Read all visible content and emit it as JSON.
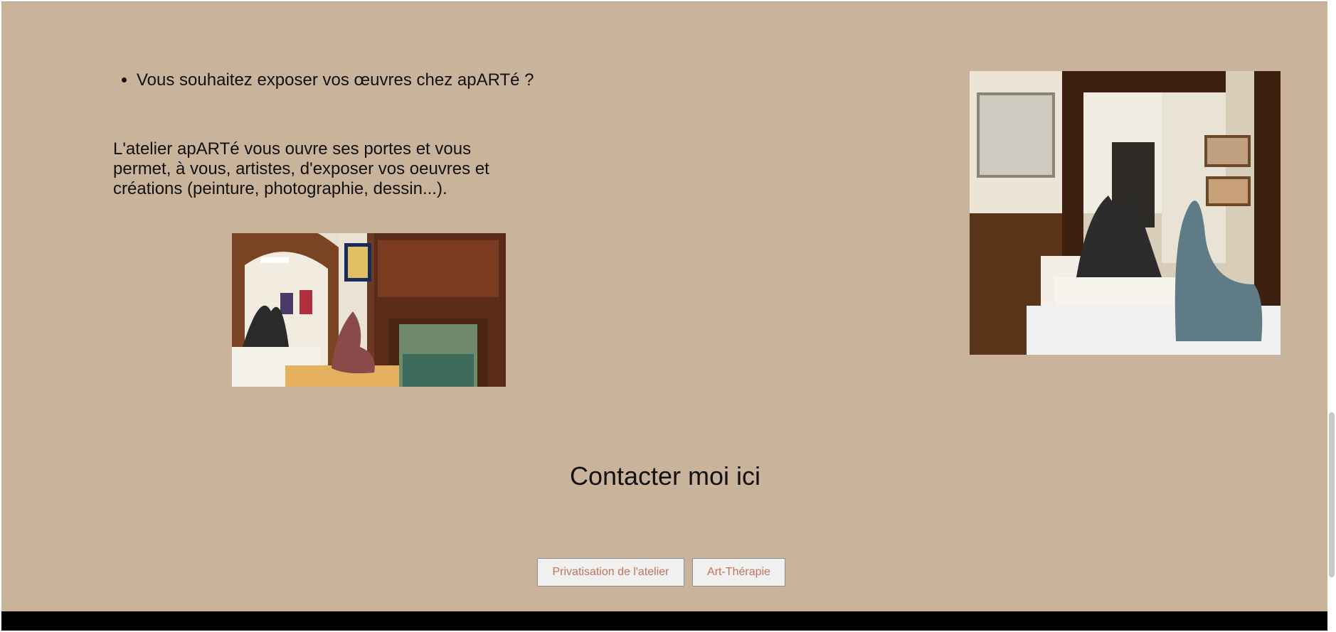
{
  "content": {
    "bullet": "Vous souhaitez exposer vos œuvres chez apARTé ?",
    "intro": "L'atelier apARTé vous ouvre ses portes et vous permet, à vous, artistes, d'exposer vos oeuvres et créations (peinture, photographie, dessin...).",
    "contact_heading": "Contacter moi ici"
  },
  "buttons": {
    "privatisation": "Privatisation de l'atelier",
    "art_therapie": "Art-Thérapie"
  },
  "colors": {
    "page_background": "#c9b49b",
    "button_text": "#c0735a",
    "footer_bar": "#000000"
  },
  "images": {
    "left": "gallery-room-sculptures-fireplace-photo",
    "right": "gallery-room-sculptures-pedestals-photo"
  }
}
